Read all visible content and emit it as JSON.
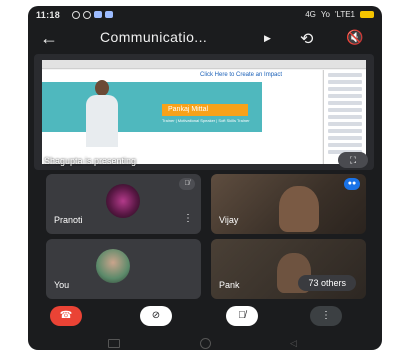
{
  "status_bar": {
    "time": "11:18",
    "network": "4G",
    "signal": "Yo",
    "lte": "'LTE1"
  },
  "toolbar": {
    "title": "Communicatio...",
    "back_icon": "back-arrow-icon",
    "switch_camera_icon": "switch-camera-icon",
    "speaker_icon": "speaker-off-icon"
  },
  "presentation": {
    "slide_link_text": "Click Here to Create an Impact",
    "presenter_name": "Pankaj Mittal",
    "presenter_subtitle": "Trainer | Motivational Speaker | Soft Skills Trainer",
    "status_text": "Shagupta is presenting"
  },
  "participants": [
    {
      "name": "Pranoti",
      "muted": true
    },
    {
      "name": "Vijay",
      "speaking": true
    },
    {
      "name": "You"
    },
    {
      "name": "Pank"
    }
  ],
  "others_count_label": "73 others",
  "controls": {
    "end_call_icon": "end-call-icon",
    "camera_icon": "camera-off-icon",
    "mic_icon": "mic-off-icon",
    "more_icon": "more-vertical-icon"
  },
  "colors": {
    "end_call": "#ea4335",
    "speaking_badge": "#1a73e8",
    "slide_accent": "#4fb8be",
    "nameplate": "#f7a21a"
  }
}
